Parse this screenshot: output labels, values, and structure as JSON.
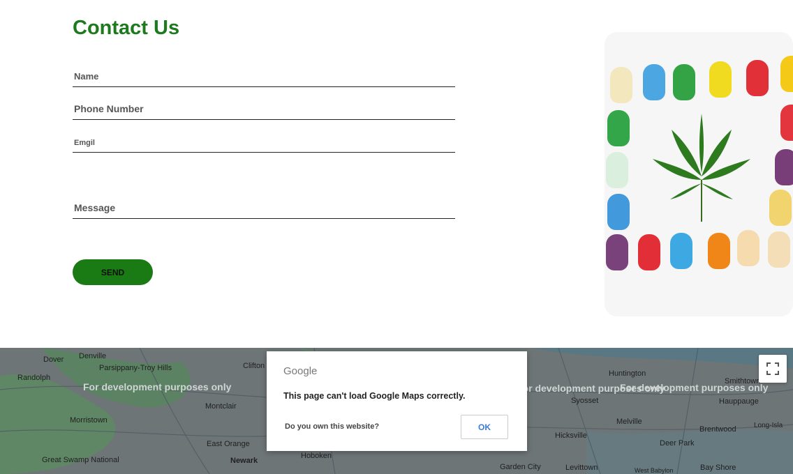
{
  "contact": {
    "title": "Contact Us",
    "fields": {
      "name": "Name",
      "phone": "Phone Number",
      "email": "Emgil",
      "message": "Message"
    },
    "send_label": "SEND"
  },
  "colors": {
    "brand_green": "#1e7a1e",
    "button_green": "#1a7a14"
  },
  "image": {
    "icon": "cannabis-leaf-icon"
  },
  "map": {
    "watermark": "For development purposes only",
    "places": [
      "Dover",
      "Denville",
      "Parsippany-Troy Hills",
      "Randolph",
      "Clifton",
      "Montclair",
      "Morristown",
      "East Orange",
      "Newark",
      "Hoboken",
      "Great Swamp National",
      "Huntington",
      "Smithtown",
      "Syosset",
      "Hauppauge",
      "Melville",
      "Brentwood",
      "Hicksville",
      "Deer Park",
      "Garden City",
      "Levittown",
      "Bay Shore",
      "West Babylon",
      "Long-Isla"
    ],
    "dialog": {
      "title": "Google",
      "message": "This page can't load Google Maps correctly.",
      "link": "Do you own this website?",
      "ok": "OK"
    },
    "fullscreen_icon": "fullscreen-icon"
  }
}
